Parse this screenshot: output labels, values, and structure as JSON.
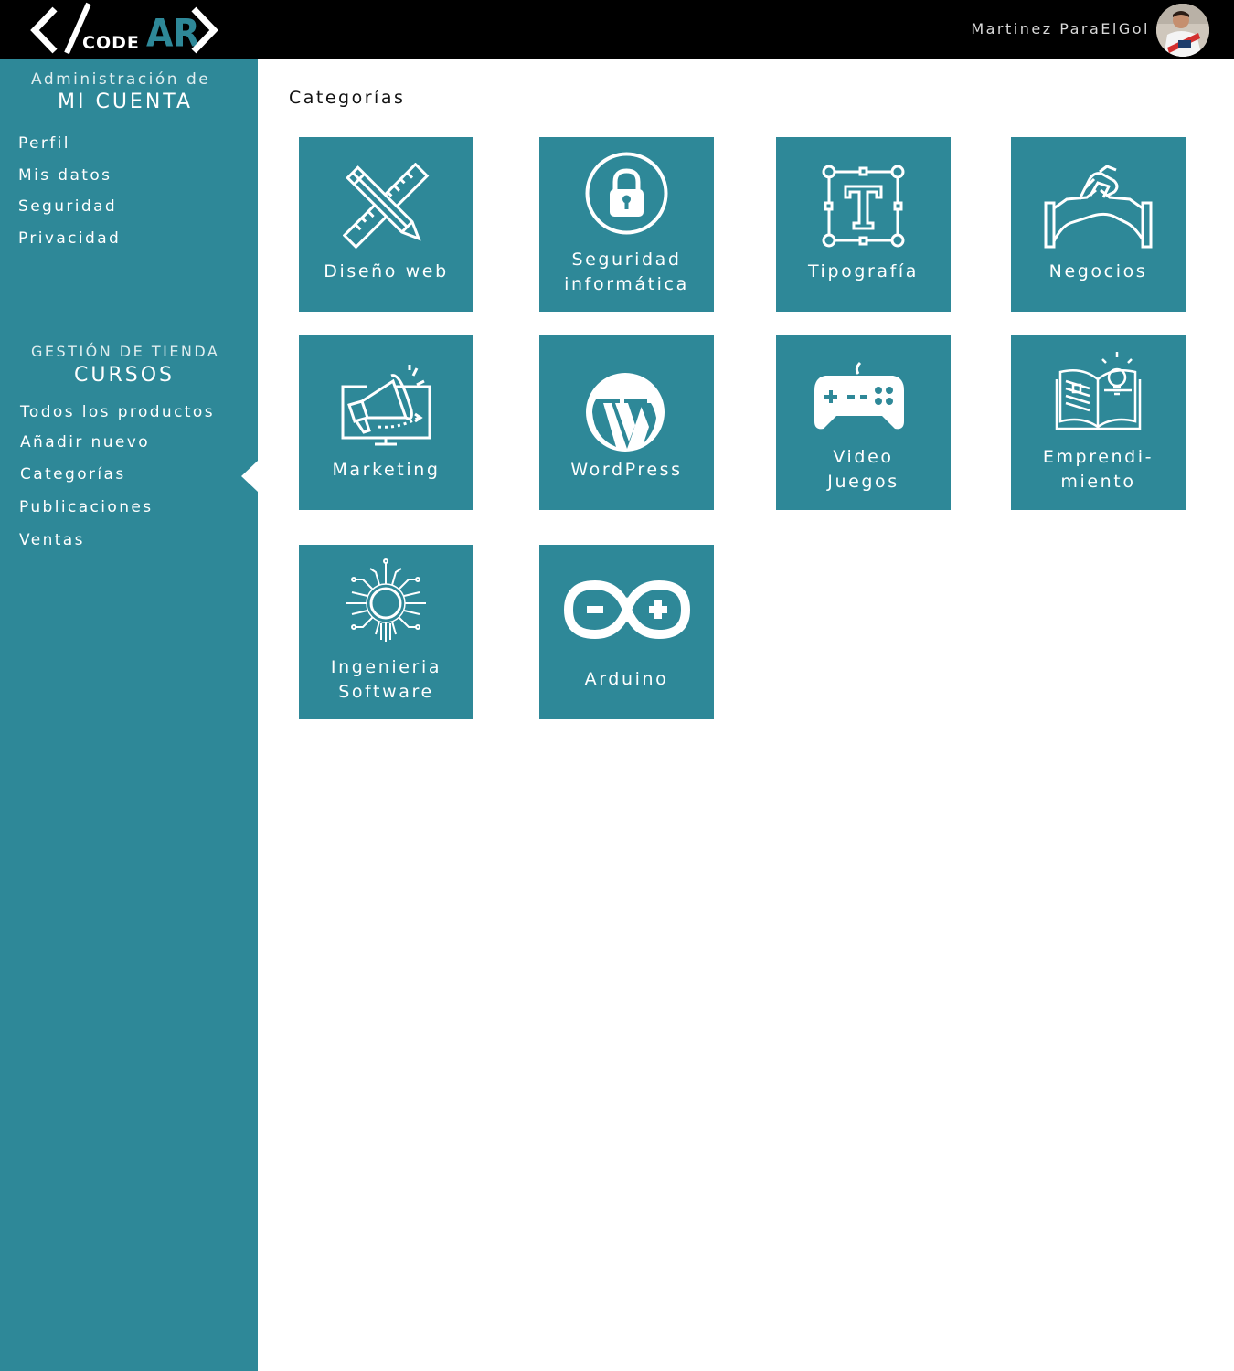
{
  "header": {
    "logo": {
      "left": "CODE",
      "right": "AR"
    },
    "user_name": "Martinez ParaElGol"
  },
  "sidebar": {
    "account_section": {
      "subtitle": "Administración de",
      "title": "MI CUENTA",
      "items": [
        {
          "label": "Perfil"
        },
        {
          "label": "Mis datos"
        },
        {
          "label": "Seguridad"
        },
        {
          "label": "Privacidad"
        }
      ]
    },
    "store_section": {
      "subtitle": "GESTIÓN DE TIENDA",
      "title": "CURSOS",
      "items": [
        {
          "label": "Todos los productos"
        },
        {
          "label": "Añadir nuevo"
        },
        {
          "label": "Categorías",
          "active": true
        },
        {
          "label": "Publicaciones"
        },
        {
          "label": "Ventas"
        }
      ]
    }
  },
  "main": {
    "title": "Categorías",
    "categories": [
      {
        "line1": "Diseño web",
        "line2": "",
        "icon": "pencil-ruler-icon"
      },
      {
        "line1": "Seguridad",
        "line2": "informática",
        "icon": "lock-icon"
      },
      {
        "line1": "Tipografía",
        "line2": "",
        "icon": "typography-icon"
      },
      {
        "line1": "Negocios",
        "line2": "",
        "icon": "handshake-icon"
      },
      {
        "line1": "Marketing",
        "line2": "",
        "icon": "megaphone-icon"
      },
      {
        "line1": "WordPress",
        "line2": "",
        "icon": "wordpress-icon"
      },
      {
        "line1": "Video",
        "line2": "Juegos",
        "icon": "gamepad-icon"
      },
      {
        "line1": "Emprendi-",
        "line2": "miento",
        "icon": "book-idea-icon"
      },
      {
        "line1": "Ingenieria",
        "line2": "Software",
        "icon": "circuit-icon"
      },
      {
        "line1": "Arduino",
        "line2": "",
        "icon": "arduino-icon"
      }
    ]
  },
  "colors": {
    "topbar": "#000000",
    "accent": "#2e8898",
    "logo_accent": "#2e8898",
    "text_light": "#ffffff"
  }
}
